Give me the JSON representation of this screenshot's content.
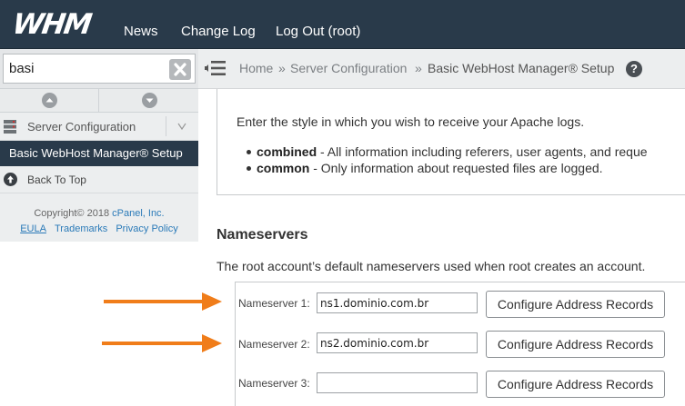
{
  "header": {
    "logo": "WHM",
    "nav": [
      "News",
      "Change Log",
      "Log Out (root)"
    ]
  },
  "sidebar": {
    "search_value": "basi",
    "category": "Server Configuration",
    "active_item": "Basic WebHost Manager® Setup",
    "back_to_top": "Back To Top",
    "copyright_prefix": "Copyright© 2018",
    "copyright_link": "cPanel, Inc.",
    "links": [
      "EULA",
      "Trademarks",
      "Privacy Policy"
    ]
  },
  "breadcrumb": {
    "items": [
      "Home",
      "Server Configuration",
      "Basic WebHost Manager® Setup"
    ],
    "separator": "»",
    "help": "?"
  },
  "apache_logs": {
    "description": "Enter the style in which you wish to receive your Apache logs.",
    "options": [
      {
        "name": "combined",
        "text": " - All information including referers, user agents, and reque"
      },
      {
        "name": "common",
        "text": " - Only information about requested files are logged."
      }
    ]
  },
  "nameservers": {
    "title": "Nameservers",
    "description": "The root account’s default nameservers used when root creates an account.",
    "button_label": "Configure Address Records",
    "rows": [
      {
        "label": "Nameserver 1:",
        "value": "ns1.dominio.com.br"
      },
      {
        "label": "Nameserver 2:",
        "value": "ns2.dominio.com.br"
      },
      {
        "label": "Nameserver 3:",
        "value": ""
      }
    ]
  },
  "colors": {
    "header_bg": "#293a4a",
    "link": "#2a7ab8",
    "annotation_arrow": "#f07d1a"
  },
  "annotations": {
    "arrows_pointing_to": [
      "Nameserver 1",
      "Nameserver 2"
    ]
  }
}
